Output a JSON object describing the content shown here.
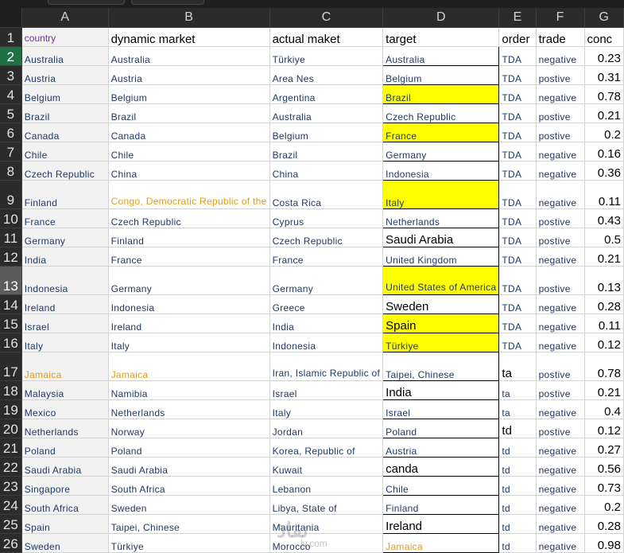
{
  "columns": [
    "A",
    "B",
    "C",
    "D",
    "E",
    "F",
    "G"
  ],
  "header_row": {
    "row": "1",
    "cells": [
      "country",
      "dynamic market",
      "actual maket",
      "target",
      "order",
      "trade",
      "conc"
    ]
  },
  "rows": [
    {
      "row": "2",
      "country": "Australia",
      "dynamic": "Australia",
      "actual": "Türkiye",
      "target": "Australia",
      "order": "TDA",
      "trade": "negative",
      "conc": "0.23"
    },
    {
      "row": "3",
      "country": "Austria",
      "dynamic": "Austria",
      "actual": "Area Nes",
      "target": "Belgium",
      "order": "TDA",
      "trade": "postive",
      "conc": "0.31"
    },
    {
      "row": "4",
      "country": "Belgium",
      "dynamic": "Belgium",
      "actual": "Argentina",
      "target": "Brazil",
      "order": "TDA",
      "trade": "negative",
      "conc": "0.78"
    },
    {
      "row": "5",
      "country": "Brazil",
      "dynamic": "Brazil",
      "actual": "Australia",
      "target": "Czech Republic",
      "order": "TDA",
      "trade": "postive",
      "conc": "0.21"
    },
    {
      "row": "6",
      "country": "Canada",
      "dynamic": "Canada",
      "actual": "Belgium",
      "target": "France",
      "order": "TDA",
      "trade": "postive",
      "conc": "0.2"
    },
    {
      "row": "7",
      "country": "Chile",
      "dynamic": "Chile",
      "actual": "Brazil",
      "target": "Germany",
      "order": "TDA",
      "trade": "negative",
      "conc": "0.16"
    },
    {
      "row": "8",
      "country": "Czech Republic",
      "dynamic": "China",
      "actual": "China",
      "target": "Indonesia",
      "order": "TDA",
      "trade": "negative",
      "conc": "0.36"
    },
    {
      "row": "9",
      "country": "Finland",
      "dynamic": "Congo, Democratic Republic of the",
      "actual": "Costa Rica",
      "target": "Italy",
      "order": "TDA",
      "trade": "negative",
      "conc": "0.11"
    },
    {
      "row": "10",
      "country": "France",
      "dynamic": "Czech Republic",
      "actual": "Cyprus",
      "target": "Netherlands",
      "order": "TDA",
      "trade": "postive",
      "conc": "0.43"
    },
    {
      "row": "11",
      "country": "Germany",
      "dynamic": "Finland",
      "actual": "Czech Republic",
      "target": "Saudi Arabia",
      "order": "TDA",
      "trade": "postive",
      "conc": "0.5"
    },
    {
      "row": "12",
      "country": "India",
      "dynamic": "France",
      "actual": "France",
      "target": "United Kingdom",
      "order": "TDA",
      "trade": "negative",
      "conc": "0.21"
    },
    {
      "row": "13",
      "country": "Indonesia",
      "dynamic": "Germany",
      "actual": "Germany",
      "target": "United States of America",
      "order": "TDA",
      "trade": "postive",
      "conc": "0.13"
    },
    {
      "row": "14",
      "country": "Ireland",
      "dynamic": "Indonesia",
      "actual": "Greece",
      "target": "Sweden",
      "order": "TDA",
      "trade": "negative",
      "conc": "0.28"
    },
    {
      "row": "15",
      "country": "Israel",
      "dynamic": "Ireland",
      "actual": "India",
      "target": "Spain",
      "order": "TDA",
      "trade": "negative",
      "conc": "0.11"
    },
    {
      "row": "16",
      "country": "Italy",
      "dynamic": "Italy",
      "actual": "Indonesia",
      "target": "Türkiye",
      "order": "TDA",
      "trade": "negative",
      "conc": "0.12"
    },
    {
      "row": "17",
      "country": "Jamaica",
      "dynamic": "Jamaica",
      "actual": "Iran, Islamic Republic of",
      "target": "Taipei, Chinese",
      "order": "ta",
      "trade": "postive",
      "conc": "0.78"
    },
    {
      "row": "18",
      "country": "Malaysia",
      "dynamic": "Namibia",
      "actual": "Israel",
      "target": "India",
      "order": "ta",
      "trade": "postive",
      "conc": "0.21"
    },
    {
      "row": "19",
      "country": "Mexico",
      "dynamic": "Netherlands",
      "actual": "Italy",
      "target": "Israel",
      "order": "ta",
      "trade": "negative",
      "conc": "0.4"
    },
    {
      "row": "20",
      "country": "Netherlands",
      "dynamic": "Norway",
      "actual": "Jordan",
      "target": "Poland",
      "order": "td",
      "trade": "postive",
      "conc": "0.12"
    },
    {
      "row": "21",
      "country": "Poland",
      "dynamic": "Poland",
      "actual": "Korea, Republic of",
      "target": "Austria",
      "order": "td",
      "trade": "negative",
      "conc": "0.27"
    },
    {
      "row": "22",
      "country": "Saudi Arabia",
      "dynamic": "Saudi Arabia",
      "actual": "Kuwait",
      "target": "canda",
      "order": "td",
      "trade": "negative",
      "conc": "0.56"
    },
    {
      "row": "23",
      "country": "Singapore",
      "dynamic": "South Africa",
      "actual": "Lebanon",
      "target": "Chile",
      "order": "td",
      "trade": "negative",
      "conc": "0.73"
    },
    {
      "row": "24",
      "country": "South Africa",
      "dynamic": "Sweden",
      "actual": "Libya, State of",
      "target": "Finland",
      "order": "td",
      "trade": "negative",
      "conc": "0.2"
    },
    {
      "row": "25",
      "country": "Spain",
      "dynamic": "Taipei, Chinese",
      "actual": "Mauritania",
      "target": "Ireland",
      "order": "td",
      "trade": "negative",
      "conc": "0.28"
    },
    {
      "row": "26",
      "country": "Sweden",
      "dynamic": "Türkiye",
      "actual": "Morocco",
      "target": "Jamaica",
      "order": "td",
      "trade": "negative",
      "conc": "0.98"
    }
  ],
  "watermark": {
    "logo": "نفاذ",
    "site": "ly.com"
  },
  "colors": {
    "highlight": "#ffff00",
    "orange_text": "#e49b0f",
    "header_purple": "#7030a0",
    "selected_row": "#1e7145"
  }
}
